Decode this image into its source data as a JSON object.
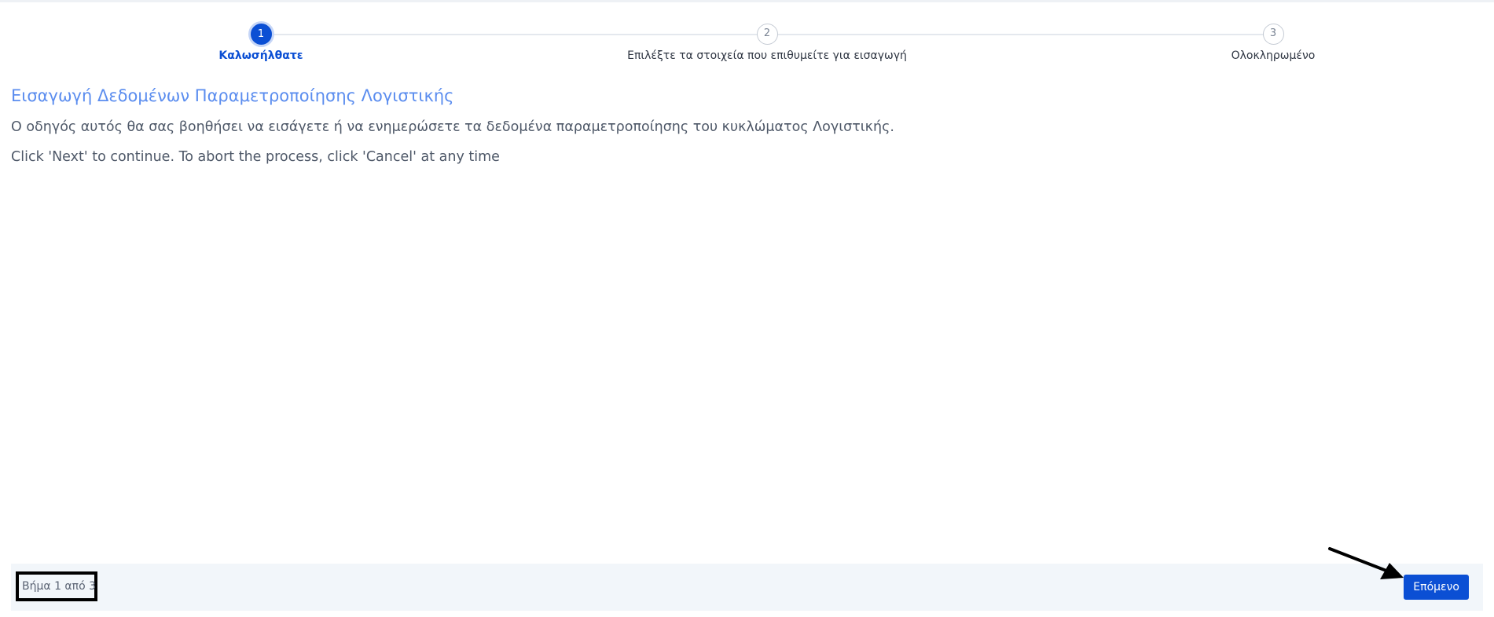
{
  "wizard": {
    "steps": [
      {
        "number": "1",
        "label": "Καλωσήλθατε",
        "active": true
      },
      {
        "number": "2",
        "label": "Επιλέξτε τα στοιχεία που επιθυμείτε για εισαγωγή",
        "active": false
      },
      {
        "number": "3",
        "label": "Ολοκληρωμένο",
        "active": false
      }
    ]
  },
  "content": {
    "title": "Εισαγωγή Δεδομένων Παραμετροποίησης Λογιστικής",
    "intro": "Ο οδηγός αυτός θα σας βοηθήσει να εισάγετε ή να ενημερώσετε τα δεδομένα παραμετροποίησης του κυκλώματος Λογιστικής.",
    "hint": "Click 'Next' to continue. To abort the process, click 'Cancel' at any time"
  },
  "footer": {
    "step_counter": "Βήμα 1 από 3",
    "next_label": "Επόμενο"
  },
  "colors": {
    "accent": "#0b4fd4",
    "title": "#5b8def",
    "footer_bg": "#f2f6fa"
  },
  "icons": {
    "annotation": "arrow-annotation-icon"
  }
}
